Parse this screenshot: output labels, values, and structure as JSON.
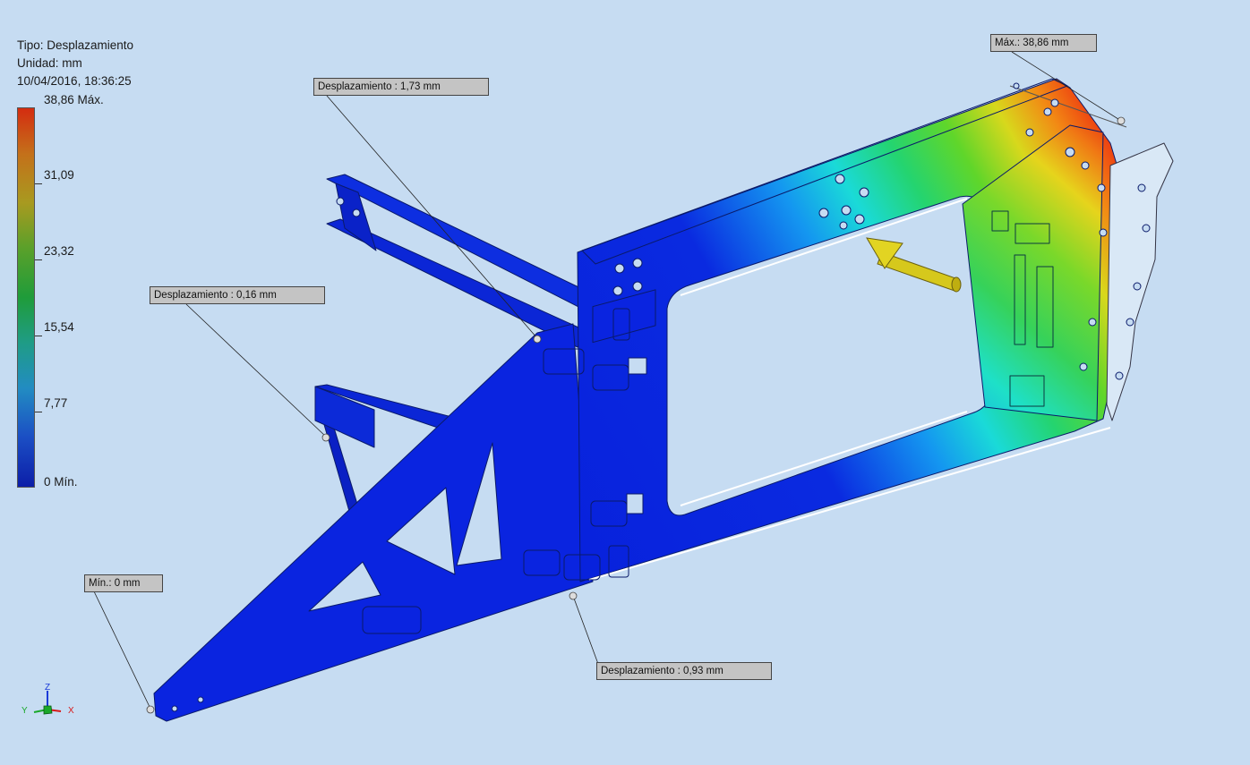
{
  "header": {
    "type_line": "Tipo: Desplazamiento",
    "unit_line": "Unidad: mm",
    "timestamp": "10/04/2016, 18:36:25"
  },
  "legend": {
    "labels": [
      "38,86 Máx.",
      "31,09",
      "23,32",
      "15,54",
      "7,77",
      "0 Mín."
    ],
    "max_value": 38.86,
    "min_value": 0,
    "colors": [
      "#d42c10",
      "#c4701a",
      "#a89a20",
      "#5aa02a",
      "#1f9c3a",
      "#1f9c86",
      "#228cc2",
      "#1b4ec4",
      "#0c1ea8"
    ]
  },
  "probes": {
    "max": "Máx.: 38,86 mm",
    "min": "Mín.: 0 mm",
    "p1": "Desplazamiento : 1,73 mm",
    "p2": "Desplazamiento : 0,16 mm",
    "p3": "Desplazamiento : 0,93 mm"
  },
  "triad": {
    "z": "Z",
    "y": "Y",
    "x": "X"
  },
  "colors": {
    "background": "#c6dcf2",
    "probe_box": "#c4c4c4",
    "load_arrow": "#d6c81c"
  }
}
